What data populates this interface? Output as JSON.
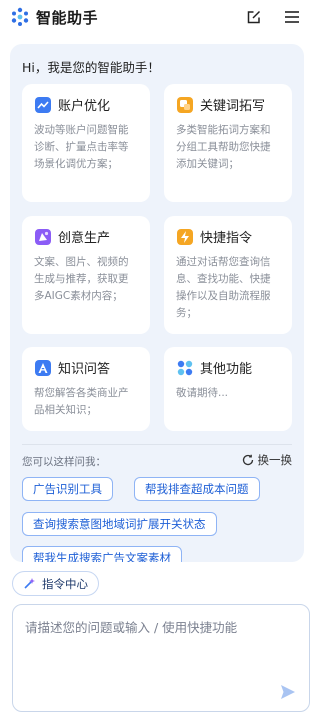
{
  "header": {
    "title": "智能助手",
    "actions": [
      "edit-icon",
      "menu-icon"
    ]
  },
  "panel": {
    "greeting": "Hi，我是您的智能助手！",
    "cards": [
      {
        "icon": "trend-chart-icon",
        "title": "账户优化",
        "desc": "波动等账户问题智能诊断、扩量点击率等场景化调优方案；",
        "color": "#3d7bf2"
      },
      {
        "icon": "keyword-expand-icon",
        "title": "关键词拓写",
        "desc": "多类智能拓词方案和分组工具帮助您快捷添加关键词；",
        "color": "#f5a623"
      },
      {
        "icon": "creative-icon",
        "title": "创意生产",
        "desc": "文案、图片、视频的生成与推荐，获取更多AIGC素材内容；",
        "color": "#8b5cf6"
      },
      {
        "icon": "lightning-command-icon",
        "title": "快捷指令",
        "desc": "通过对话帮您查询信息、查找功能、快捷操作以及自助流程服务；",
        "color": "#f5a623"
      },
      {
        "icon": "knowledge-qa-icon",
        "title": "知识问答",
        "desc": "帮您解答各类商业产品相关知识；",
        "color": "#3d7bf2"
      },
      {
        "icon": "other-functions-icon",
        "title": "其他功能",
        "desc": "敬请期待...",
        "color": "#3d7bf2"
      }
    ],
    "ask_label": "您可以这样问我：",
    "refresh_label": "换一换",
    "suggestions": [
      "广告识别工具",
      "帮我排查超成本问题",
      "查询搜索意图地域词扩展开关状态",
      "帮我生成搜索广告文案素材"
    ]
  },
  "command_center": {
    "label": "指令中心"
  },
  "input": {
    "placeholder": "请描述您的问题或输入 / 使用快捷功能",
    "value": ""
  },
  "colors": {
    "accent": "#1e5fd6",
    "panel_bg": "#eef3fb",
    "chip_border": "#8fb4f5"
  }
}
